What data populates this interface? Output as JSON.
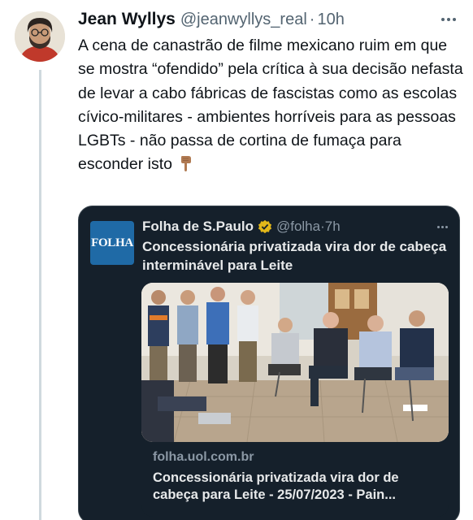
{
  "tweet": {
    "author_name": "Jean Wyllys",
    "handle": "@jeanwyllys_real",
    "separator": "·",
    "time": "10h",
    "text": "A cena de canastrão de filme mexicano ruim em que se mostra “ofendido” pela crítica à sua decisão nefasta de levar a cabo fábricas de fascistas como as escolas cívico-militares - ambientes horríveis para as pessoas LGBTs - não passa de cortina de fumaça para esconder isto",
    "emoji": "pointing-down-finger-icon"
  },
  "quoted": {
    "logo_text": "FOLHA",
    "author_name": "Folha de S.Paulo",
    "handle": "@folha",
    "separator": "·",
    "time": "7h",
    "text": "Concessionária privatizada vira dor de cabeça interminável para Leite",
    "link": {
      "domain": "folha.uol.com.br",
      "title": "Concessionária privatizada vira dor de cabeça para Leite - 25/07/2023 - Pain..."
    }
  },
  "colors": {
    "text_primary": "#0f1419",
    "text_secondary": "#536471",
    "card_background": "#15202b",
    "card_text": "#e7e9ea",
    "card_secondary": "#8b98a5",
    "folha_blue": "#1f6aa6",
    "verified_gold": "#e2b719"
  }
}
